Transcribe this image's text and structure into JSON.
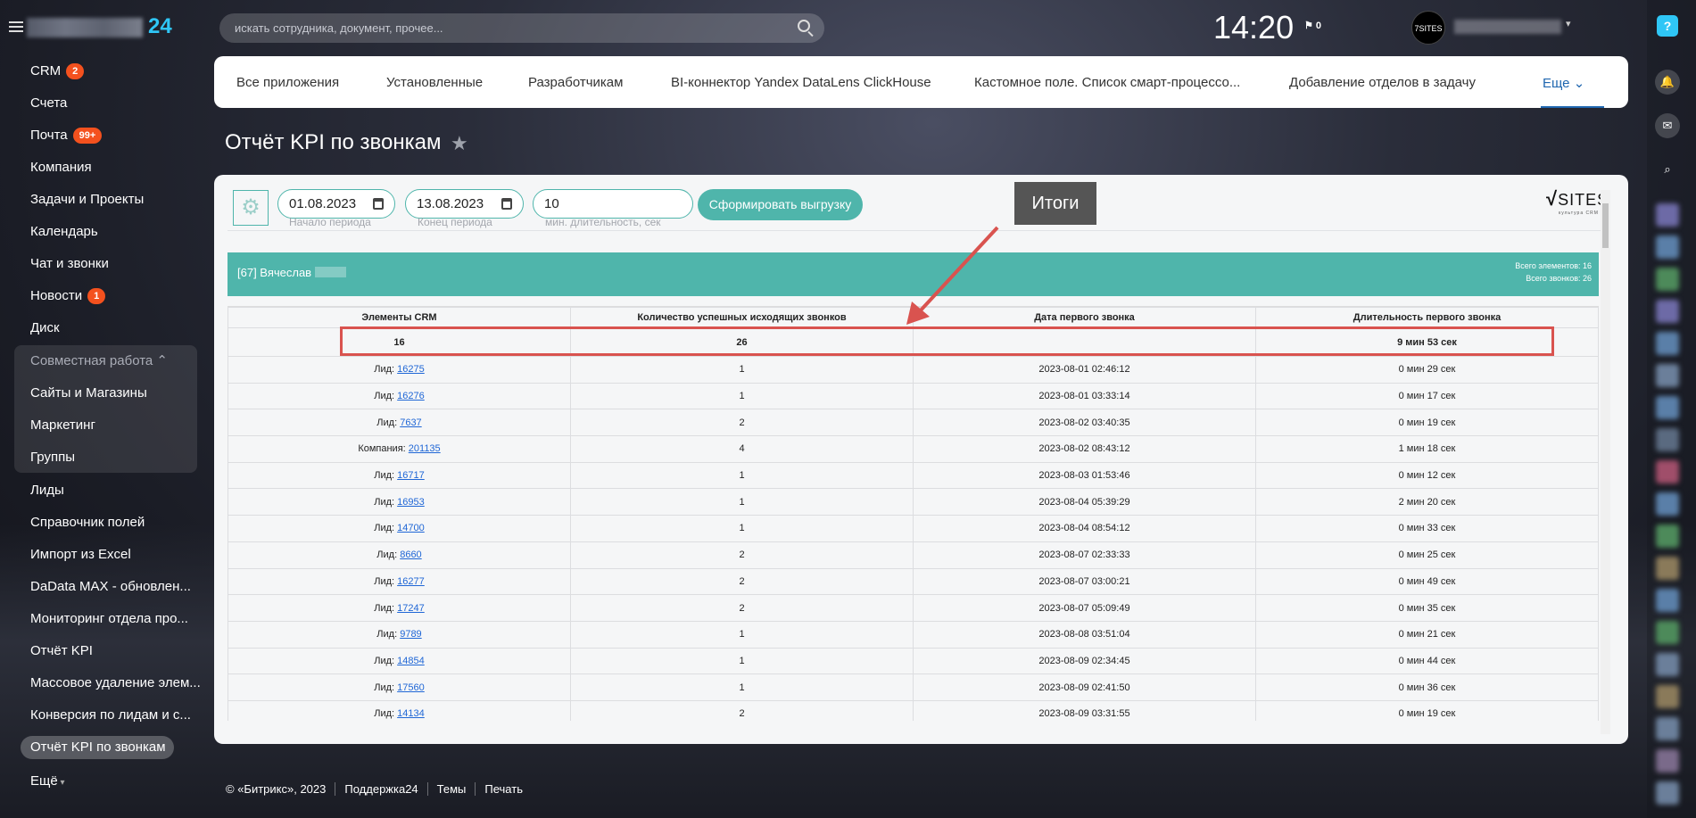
{
  "header": {
    "logo_suffix": "24",
    "search_placeholder": "искать сотрудника, документ, прочее...",
    "time": "14:20",
    "flag_count": "0",
    "avatar_text": "7SITES"
  },
  "sidebar": {
    "items": [
      {
        "label": "CRM",
        "badge": "2"
      },
      {
        "label": "Счета"
      },
      {
        "label": "Почта",
        "badge": "99+"
      },
      {
        "label": "Компания"
      },
      {
        "label": "Задачи и Проекты"
      },
      {
        "label": "Календарь"
      },
      {
        "label": "Чат и звонки"
      },
      {
        "label": "Новости",
        "badge": "1"
      },
      {
        "label": "Диск"
      }
    ],
    "group": {
      "label": "Совместная работа",
      "items": [
        "Сайты и Магазины",
        "Маркетинг",
        "Группы"
      ]
    },
    "more_items": [
      "Лиды",
      "Справочник полей",
      "Импорт из Excel",
      "DaData MAX - обновлен...",
      "Мониторинг отдела про...",
      "Отчёт KPI",
      "Массовое удаление элем...",
      "Конверсия по лидам и с...",
      "Отчёт KPI по звонкам"
    ],
    "active": "Отчёт KPI по звонкам",
    "more": "Ещё"
  },
  "tabs": [
    "Все приложения",
    "Установленные",
    "Разработчикам",
    "BI-коннектор Yandex DataLens ClickHouse",
    "Кастомное поле. Список смарт-процессо...",
    "Добавление отделов в задачу",
    "Еще"
  ],
  "page_title": "Отчёт KPI по звонкам",
  "filters": {
    "start": "01.08.2023",
    "start_label": "Начало периода",
    "end": "13.08.2023",
    "end_label": "Конец периода",
    "min_duration": "10",
    "min_duration_label": "мин. длительность, сек",
    "submit": "Сформировать выгрузку"
  },
  "brand_logo": {
    "text": "SITES",
    "sub": "культура CRM"
  },
  "employee": {
    "name": "[67] Вячеслав",
    "total_elements": "Всего элементов: 16",
    "total_calls": "Всего звонков: 26"
  },
  "table": {
    "columns": [
      "Элементы CRM",
      "Количество успешных исходящих звонков",
      "Дата первого звонка",
      "Длительность первого звонка"
    ],
    "totals": [
      "16",
      "26",
      "",
      "9 мин 53 сек"
    ],
    "rows": [
      [
        "Лид:",
        "16275",
        "1",
        "2023-08-01 02:46:12",
        "0 мин 29 сек"
      ],
      [
        "Лид:",
        "16276",
        "1",
        "2023-08-01 03:33:14",
        "0 мин 17 сек"
      ],
      [
        "Лид:",
        "7637",
        "2",
        "2023-08-02 03:40:35",
        "0 мин 19 сек"
      ],
      [
        "Компания:",
        "201135",
        "4",
        "2023-08-02 08:43:12",
        "1 мин 18 сек"
      ],
      [
        "Лид:",
        "16717",
        "1",
        "2023-08-03 01:53:46",
        "0 мин 12 сек"
      ],
      [
        "Лид:",
        "16953",
        "1",
        "2023-08-04 05:39:29",
        "2 мин 20 сек"
      ],
      [
        "Лид:",
        "14700",
        "1",
        "2023-08-04 08:54:12",
        "0 мин 33 сек"
      ],
      [
        "Лид:",
        "8660",
        "2",
        "2023-08-07 02:33:33",
        "0 мин 25 сек"
      ],
      [
        "Лид:",
        "16277",
        "2",
        "2023-08-07 03:00:21",
        "0 мин 49 сек"
      ],
      [
        "Лид:",
        "17247",
        "2",
        "2023-08-07 05:09:49",
        "0 мин 35 сек"
      ],
      [
        "Лид:",
        "9789",
        "1",
        "2023-08-08 03:51:04",
        "0 мин 21 сек"
      ],
      [
        "Лид:",
        "14854",
        "1",
        "2023-08-09 02:34:45",
        "0 мин 44 сек"
      ],
      [
        "Лид:",
        "17560",
        "1",
        "2023-08-09 02:41:50",
        "0 мин 36 сек"
      ],
      [
        "Лид:",
        "14134",
        "2",
        "2023-08-09 03:31:55",
        "0 мин 19 сек"
      ]
    ]
  },
  "annotation": {
    "label": "Итоги",
    "color": "#d9534f"
  },
  "footer": [
    "© «Битрикс», 2023",
    "Поддержка24",
    "Темы",
    "Печать"
  ],
  "colors": {
    "accent": "#4fb5ab",
    "badge": "#f4511e",
    "link": "#2067d6",
    "logo24": "#2fc6f6"
  }
}
